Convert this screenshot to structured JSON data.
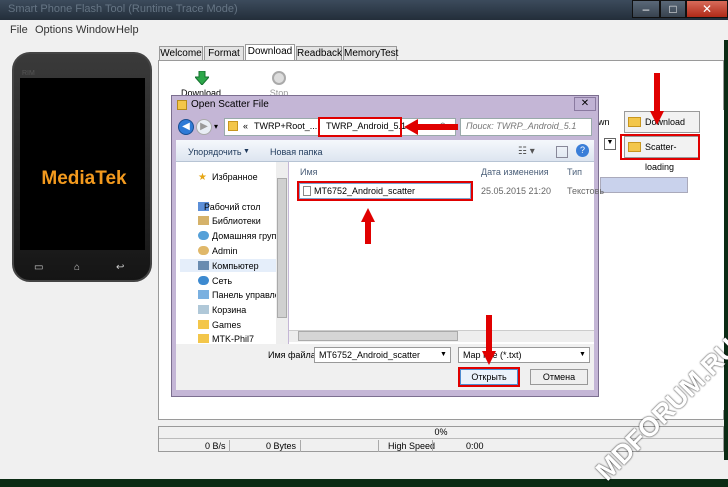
{
  "app": {
    "title": "Smart Phone Flash Tool (Runtime Trace Mode)",
    "menu": [
      "File",
      "Options",
      "Window",
      "Help"
    ]
  },
  "phone": {
    "brand": "MediaTek",
    "top_label": "RIM"
  },
  "tabs": [
    "Welcome",
    "Format",
    "Download",
    "Readback",
    "MemoryTest"
  ],
  "toolbar": {
    "download_label": "Download",
    "stop_label": "Stop"
  },
  "side_buttons": {
    "download_agent": "Download Agent",
    "scatter_loading": "Scatter-loading",
    "partial_download": "wn"
  },
  "dialog": {
    "title": "Open Scatter File",
    "address": {
      "prefix": "«",
      "crumb1": "TWRP+Root_...",
      "crumb2": "TWRP_Android_5.1"
    },
    "search_placeholder": "Поиск: TWRP_Android_5.1",
    "organize": "Упорядочить",
    "new_folder": "Новая папка",
    "nav_items": [
      "Избранное",
      "Рабочий стол",
      "Библиотеки",
      "Домашняя груп",
      "Admin",
      "Компьютер",
      "Сеть",
      "Панель управле",
      "Корзина",
      "Games",
      "MTK-Phil7"
    ],
    "columns": {
      "name": "Имя",
      "date": "Дата изменения",
      "type": "Тип"
    },
    "file": {
      "name": "MT6752_Android_scatter",
      "date": "25.05.2015 21:20",
      "type": "Текстовь"
    },
    "filename_label": "Имя файла:",
    "filename_value": "MT6752_Android_scatter",
    "filetype_value": "Map File (*.txt)",
    "open_label": "Открыть",
    "cancel_label": "Отмена"
  },
  "status": {
    "progress": "0%",
    "speed": "0 B/s",
    "bytes": "0 Bytes",
    "mode": "High Speed",
    "time": "0:00"
  },
  "watermark": "MDFORUM.RU",
  "colors": {
    "annotation": "#e00000",
    "brand": "#f39a1e",
    "background": "#0b2b14"
  }
}
